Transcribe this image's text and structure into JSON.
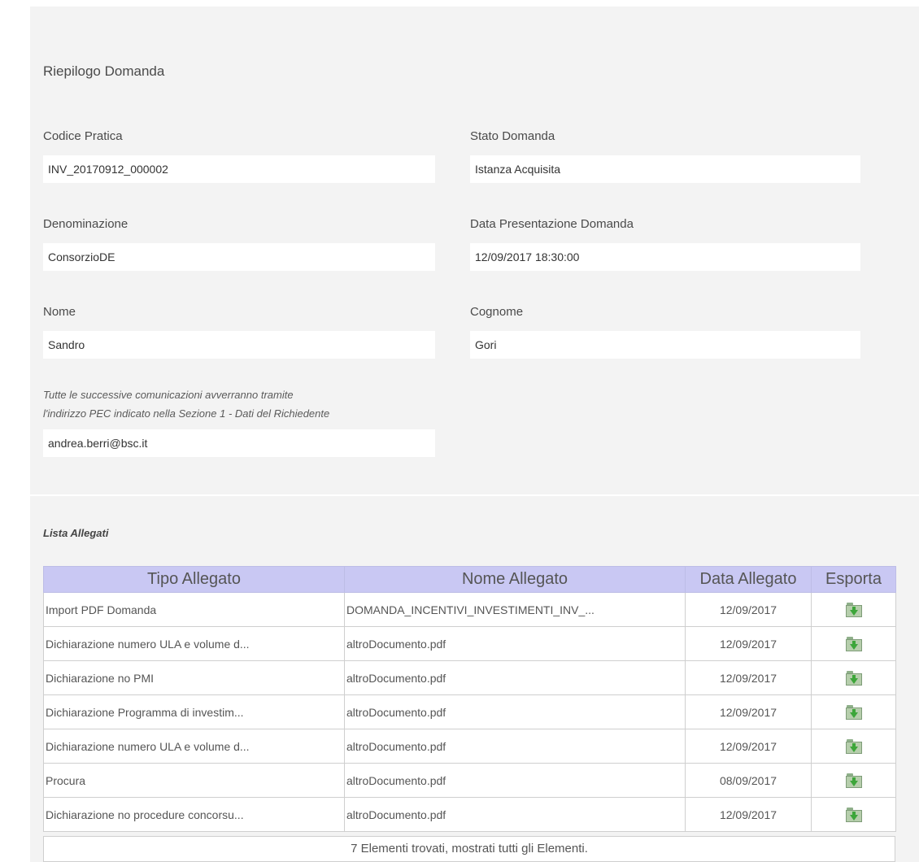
{
  "summary": {
    "title": "Riepilogo Domanda",
    "codice_pratica": {
      "label": "Codice Pratica",
      "value": "INV_20170912_000002"
    },
    "stato_domanda": {
      "label": "Stato Domanda",
      "value": "Istanza Acquisita"
    },
    "denominazione": {
      "label": "Denominazione",
      "value": "ConsorzioDE"
    },
    "data_presentazione": {
      "label": "Data Presentazione Domanda",
      "value": "12/09/2017 18:30:00"
    },
    "nome": {
      "label": "Nome",
      "value": "Sandro"
    },
    "cognome": {
      "label": "Cognome",
      "value": "Gori"
    },
    "note_line1": "Tutte le successive comunicazioni avverranno tramite",
    "note_line2": "l'indirizzo PEC indicato nella Sezione 1 - Dati del Richiedente",
    "pec": "andrea.berri@bsc.it"
  },
  "attachments": {
    "title": "Lista Allegati",
    "headers": [
      "Tipo Allegato",
      "Nome Allegato",
      "Data Allegato",
      "Esporta"
    ],
    "rows": [
      {
        "tipo": "Import PDF Domanda",
        "nome": "DOMANDA_INCENTIVI_INVESTIMENTI_INV_...",
        "data": "12/09/2017"
      },
      {
        "tipo": "Dichiarazione numero ULA e volume d...",
        "nome": "altroDocumento.pdf",
        "data": "12/09/2017"
      },
      {
        "tipo": "Dichiarazione no PMI",
        "nome": "altroDocumento.pdf",
        "data": "12/09/2017"
      },
      {
        "tipo": "Dichiarazione Programma di investim...",
        "nome": "altroDocumento.pdf",
        "data": "12/09/2017"
      },
      {
        "tipo": "Dichiarazione numero ULA e volume d...",
        "nome": "altroDocumento.pdf",
        "data": "12/09/2017"
      },
      {
        "tipo": "Procura",
        "nome": "altroDocumento.pdf",
        "data": "08/09/2017"
      },
      {
        "tipo": "Dichiarazione no procedure concorsu...",
        "nome": "altroDocumento.pdf",
        "data": "12/09/2017"
      }
    ],
    "export_icon": "folder-download-icon",
    "footer": "7 Elementi trovati, mostrati tutti gli Elementi."
  },
  "colors": {
    "header_bg": "#c9c8f3",
    "panel_bg": "#f3f3f3",
    "download_arrow": "#3da63a"
  }
}
